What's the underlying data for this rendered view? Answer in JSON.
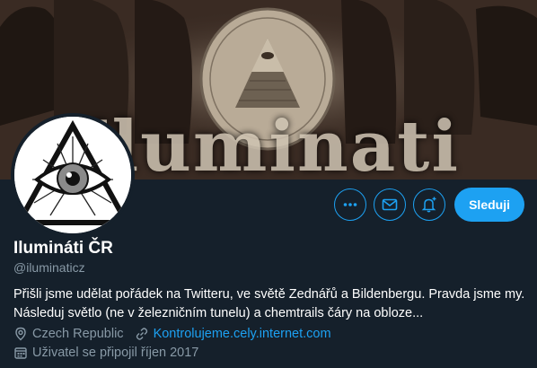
{
  "banner": {
    "text": "Iluminati"
  },
  "profile": {
    "name": "Ilumináti ČR",
    "handle": "@iluminaticz",
    "bio": "Přišli jsme udělat pořádek na Twitteru, ve světě Zednářů a Bildenbergu. Pravda jsme my. Následuj světlo (ne v železničním tunelu) a chemtrails čáry na obloze...",
    "location": "Czech Republic",
    "website": "Kontrolujeme.cely.internet.com",
    "joined": "Uživatel se připojil říjen 2017"
  },
  "actions": {
    "follow_label": "Sleduji",
    "more_icon": "more-icon",
    "message_icon": "envelope-icon",
    "notify_icon": "bell-plus-icon"
  },
  "colors": {
    "background": "#15202b",
    "accent": "#1da1f2",
    "secondary_text": "#8899a6"
  }
}
